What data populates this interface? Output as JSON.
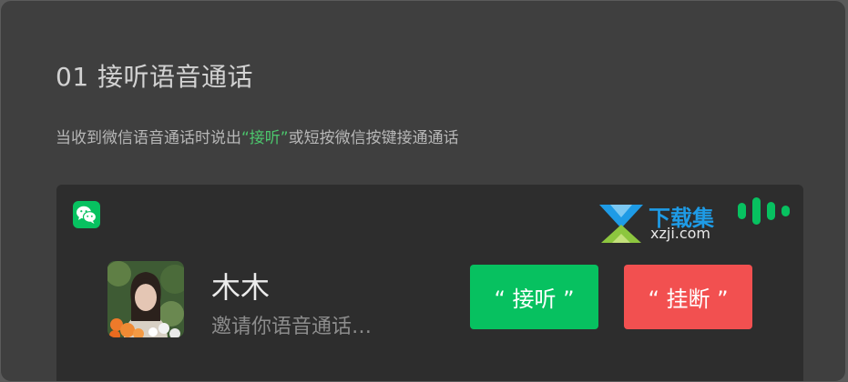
{
  "section": {
    "title": "01 接听语音通话",
    "description_before": "当收到微信语音通话时说出",
    "description_highlight": "“接听”",
    "description_after": "或短按微信按键接通通话"
  },
  "call_card": {
    "app_icon": "wechat-icon",
    "caller_name": "木木",
    "caller_status": "邀请你语音通话…",
    "answer_label": "“ 接听 ”",
    "hangup_label": "“ 挂断 ”"
  },
  "watermark": {
    "name": "下载集",
    "url": "xzji.com"
  },
  "colors": {
    "accent_green": "#07c160",
    "highlight_green": "#4cc76d",
    "hangup_red": "#f25050",
    "watermark_blue": "#1e9be6"
  }
}
